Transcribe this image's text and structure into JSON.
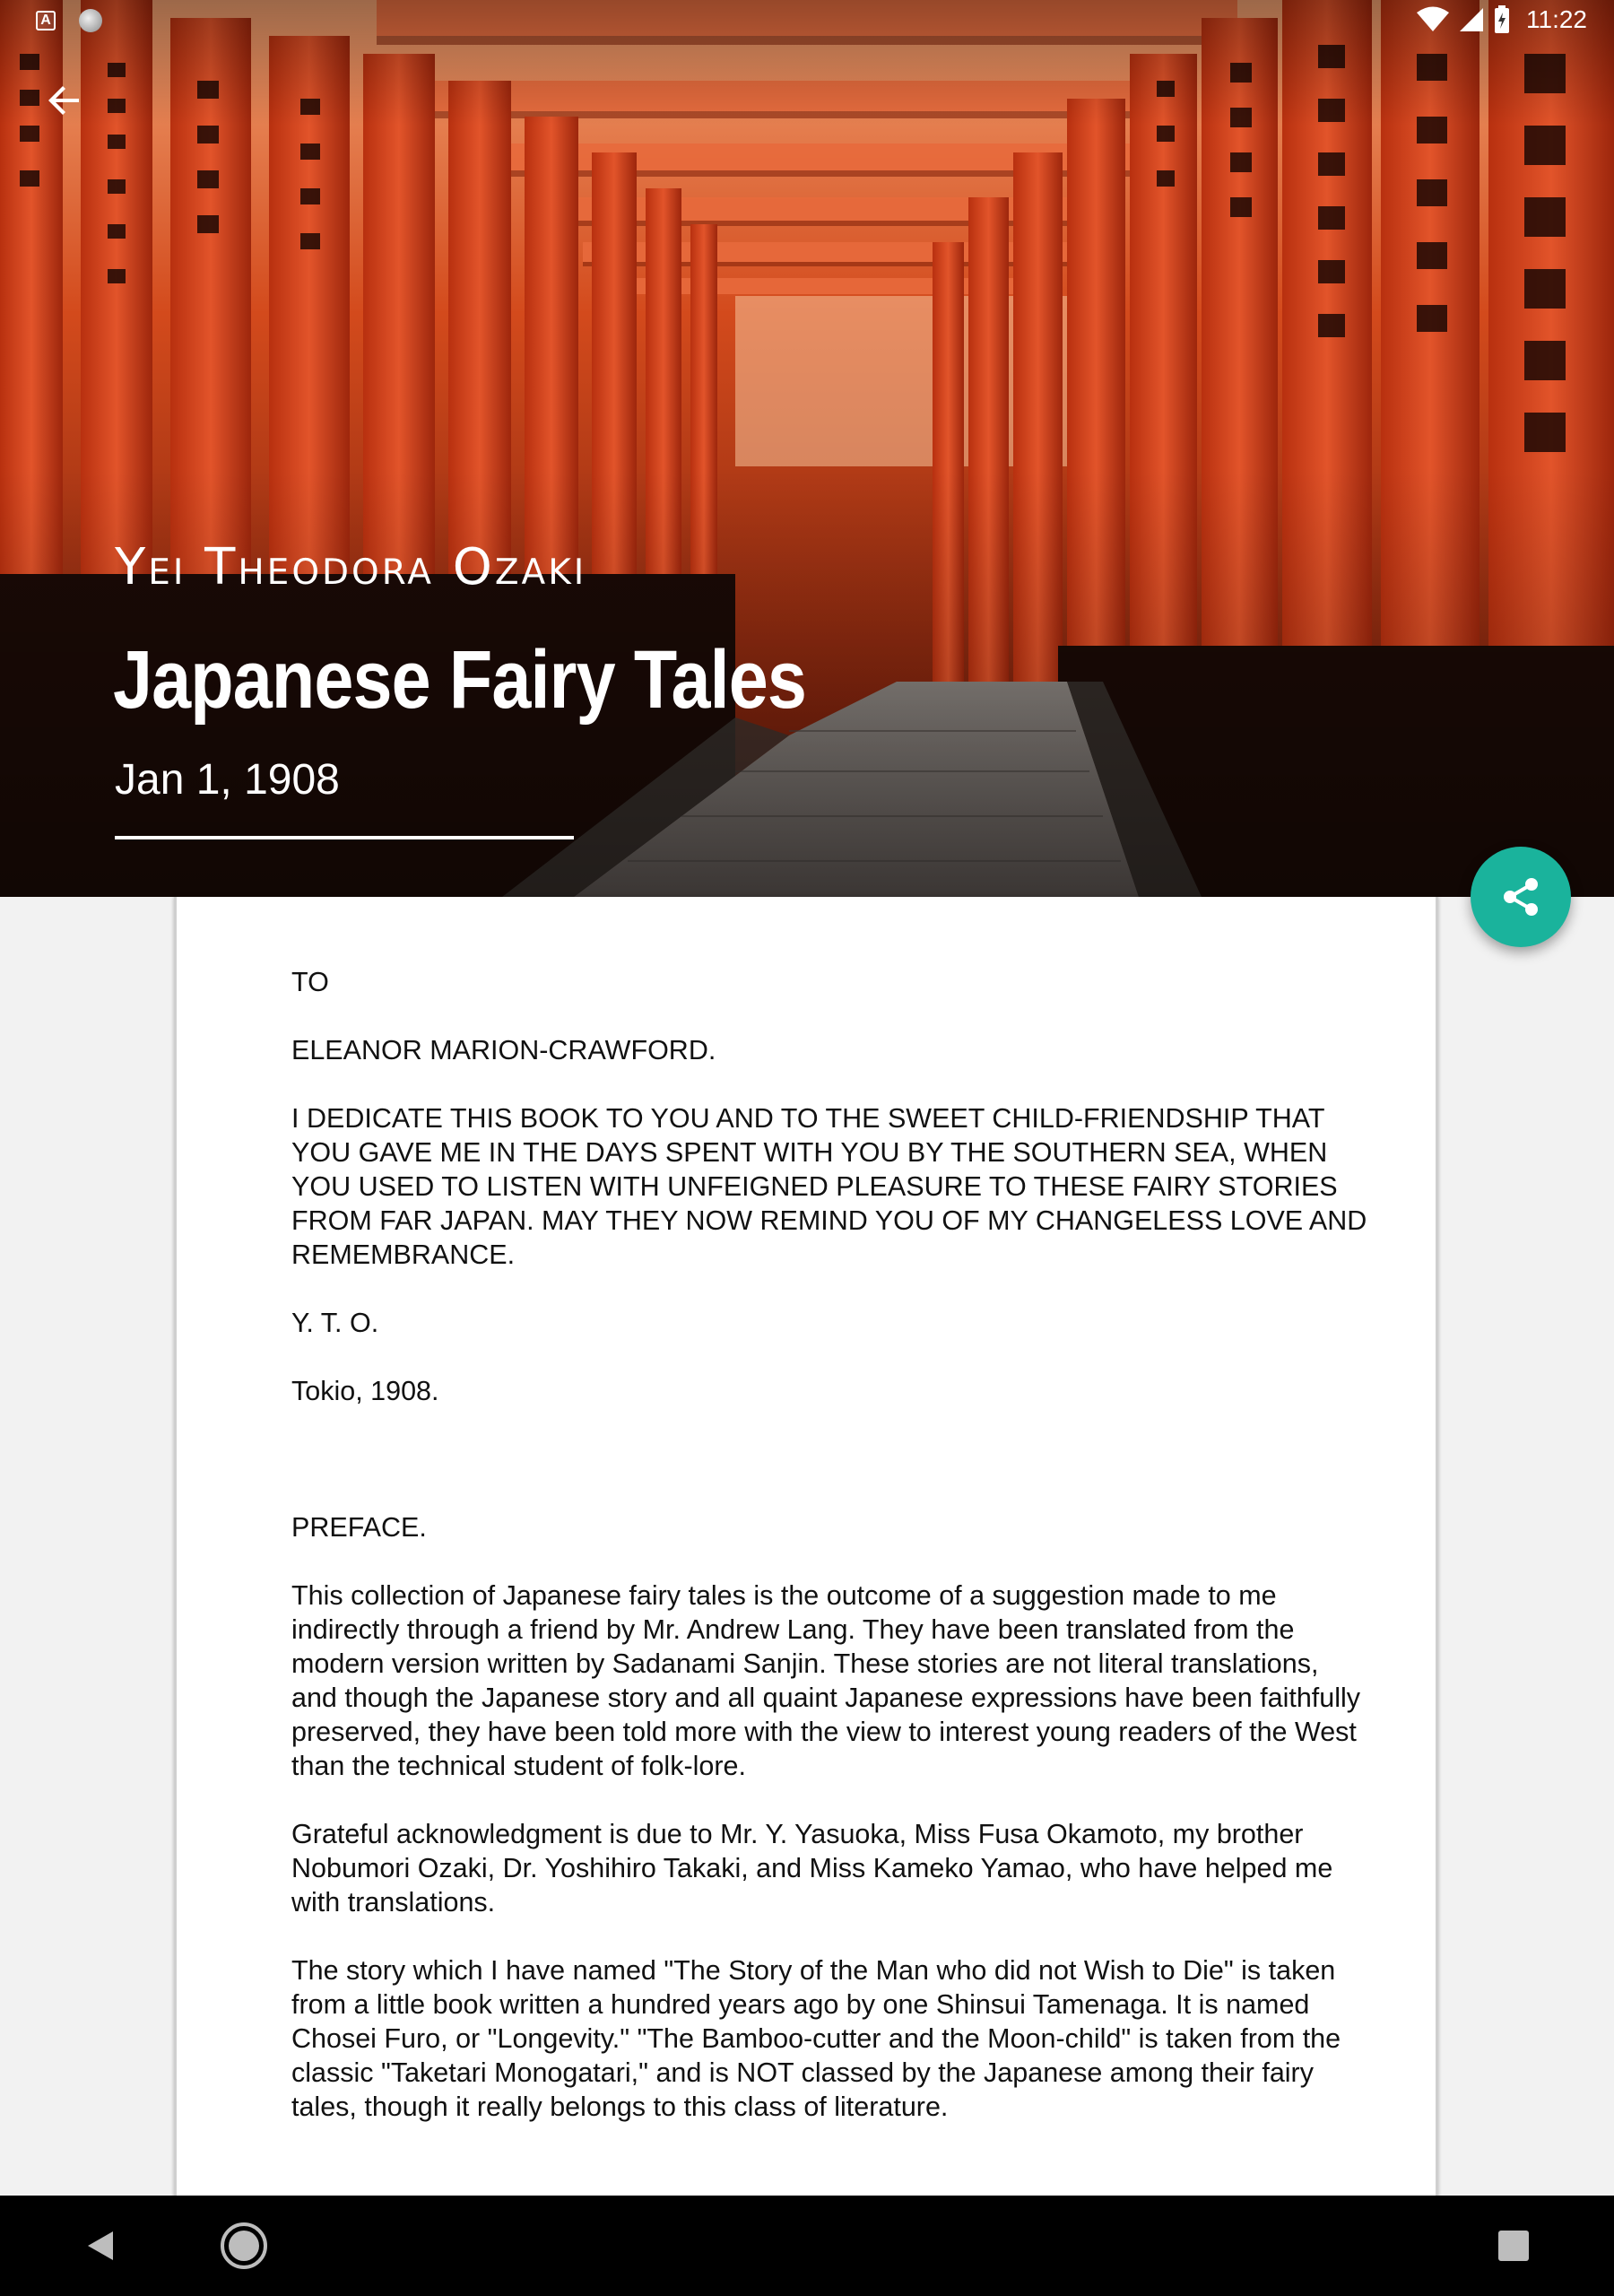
{
  "status_bar": {
    "time": "11:22",
    "left_icons": [
      "app-a-icon",
      "circle-notification-icon"
    ],
    "right_icons": [
      "wifi-icon",
      "cellular-signal-icon",
      "battery-icon"
    ],
    "app_icon_letter": "A"
  },
  "toolbar": {
    "back_icon": "arrow-back-icon"
  },
  "book": {
    "author": "Yei Theodora Ozaki",
    "title": "Japanese Fairy Tales",
    "date": "Jan 1, 1908"
  },
  "fab": {
    "icon": "share-icon",
    "color": "#1ab39c"
  },
  "content": {
    "paragraphs": [
      "TO",
      "ELEANOR MARION-CRAWFORD.",
      "I DEDICATE THIS BOOK TO YOU AND TO THE SWEET CHILD-FRIENDSHIP THAT YOU GAVE ME IN THE DAYS SPENT WITH YOU BY THE SOUTHERN SEA, WHEN YOU USED TO LISTEN WITH UNFEIGNED PLEASURE TO THESE FAIRY STORIES FROM FAR JAPAN. MAY THEY NOW REMIND YOU OF MY CHANGELESS LOVE AND REMEMBRANCE.",
      "Y. T. O.",
      "Tokio, 1908.",
      "",
      "PREFACE.",
      "This collection of Japanese fairy tales is the outcome of a suggestion made to me indirectly through a friend by Mr. Andrew Lang. They have been translated from the modern version written by Sadanami Sanjin. These stories are not literal translations, and though the Japanese story and all quaint Japanese expressions have been faithfully preserved, they have been told more with the view to interest young readers of the West than the technical student of folk-lore.",
      "Grateful acknowledgment is due to Mr. Y. Yasuoka, Miss Fusa Okamoto, my brother Nobumori Ozaki, Dr. Yoshihiro Takaki, and Miss Kameko Yamao, who have helped me with translations.",
      "The story which I have named \"The Story of the Man who did not Wish to Die\" is taken from a little book written a hundred years ago by one Shinsui Tamenaga. It is named Chosei Furo, or \"Longevity.\" \"The Bamboo-cutter and the Moon-child\" is taken from the classic \"Taketari Monogatari,\" and is NOT classed by the Japanese among their fairy tales, though it really belongs to this class of literature."
    ]
  },
  "nav_bar": {
    "icons": [
      "back-triangle-icon",
      "home-circle-icon",
      "recents-square-icon"
    ]
  },
  "colors": {
    "torii_red": "#d8401c",
    "card_background": "#ffffff",
    "page_background": "#f2f2f2"
  }
}
